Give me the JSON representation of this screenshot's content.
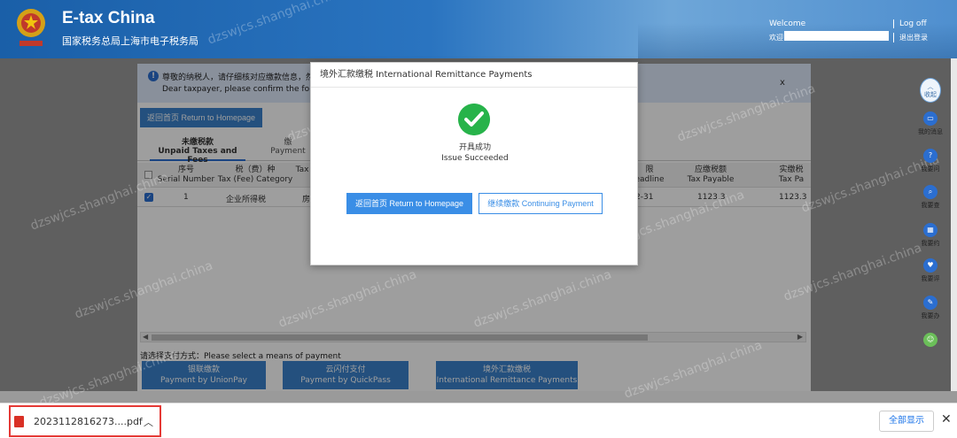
{
  "header": {
    "title": "E-tax China",
    "subtitle": "国家税务总局上海市电子税务局",
    "welcome_en": "Welcome",
    "welcome_cn": "欢迎",
    "logoff_en": "Log off",
    "logoff_cn": "退出登录"
  },
  "notice": {
    "line1": "尊敬的纳税人，请仔细核对应缴款信息，然",
    "line2": "Dear taxpayer, please confirm the follow",
    "close": "x"
  },
  "return_home_label": "返回首页 Return to Homepage",
  "tabs": [
    {
      "cn": "未缴税款",
      "en": "Unpaid Taxes and Fees"
    },
    {
      "cn": "缴",
      "en": "Payment"
    }
  ],
  "table": {
    "headers": [
      {
        "cn": "序号",
        "en": "Serial Number"
      },
      {
        "cn": "税（费）种",
        "en": "Tax (Fee) Category"
      },
      {
        "cn": "",
        "en": "Tax"
      },
      {
        "cn": "限",
        "en": "eadline"
      },
      {
        "cn": "应缴税额",
        "en": "Tax Payable"
      },
      {
        "cn": "实缴税",
        "en": "Tax Pa"
      }
    ],
    "rows": [
      {
        "serial": "1",
        "category": "企业所得税",
        "tax": "房",
        "deadline": "2-31",
        "payable": "1123.3",
        "paid": "1123.3"
      }
    ]
  },
  "payment": {
    "label": "请选择支付方式：Please select a means of payment",
    "options": [
      {
        "cn": "银联缴款",
        "en": "Payment by UnionPay"
      },
      {
        "cn": "云闪付支付",
        "en": "Payment by QuickPass"
      },
      {
        "cn": "境外汇款缴税",
        "en": "International Remittance Payments"
      }
    ]
  },
  "modal": {
    "title": "境外汇款缴税 International Remittance Payments",
    "status_cn": "开具成功",
    "status_en": "Issue Succeeded",
    "btn_home": "返回首页 Return to Homepage",
    "btn_continue": "继续缴款 Continuing Payment"
  },
  "sidebar": {
    "collapse": "收起",
    "items": [
      {
        "label": "我的消息",
        "icon": "message-icon"
      },
      {
        "label": "我要问",
        "icon": "question-icon"
      },
      {
        "label": "我要查",
        "icon": "search-icon"
      },
      {
        "label": "我要约",
        "icon": "calendar-icon"
      },
      {
        "label": "我要评",
        "icon": "rating-icon"
      },
      {
        "label": "我要办",
        "icon": "edit-icon"
      }
    ]
  },
  "download": {
    "filename": "2023112816273....pdf",
    "show_all": "全部显示",
    "close": "✕"
  },
  "watermark_text": "dzswjcs.shanghai.china",
  "colors": {
    "header_blue": "#1a5fa8",
    "accent_blue": "#3a82cc",
    "success_green": "#27b34a",
    "highlight_red": "#e53935"
  }
}
